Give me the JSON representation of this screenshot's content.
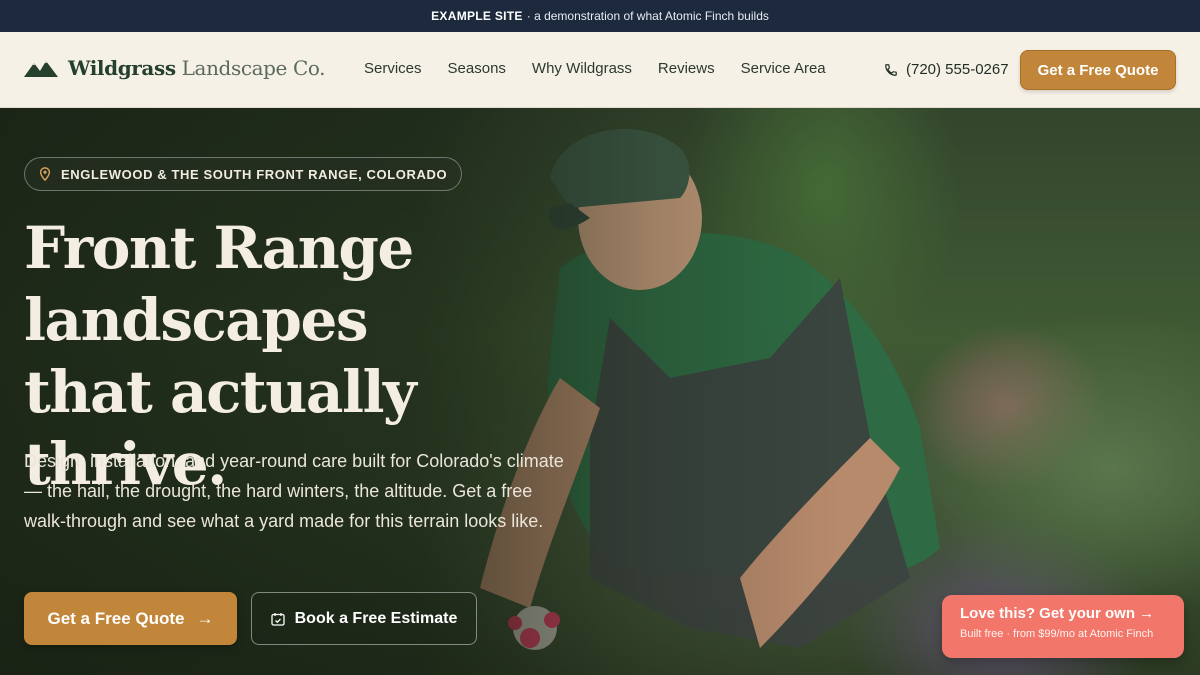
{
  "banner": {
    "strong": "EXAMPLE SITE",
    "rest": "· a demonstration of what Atomic Finch builds"
  },
  "brand": {
    "name_strong": "Wildgrass",
    "name_rest": "Landscape Co.",
    "icon": "mountain-logo-icon"
  },
  "nav": {
    "links": [
      "Services",
      "Seasons",
      "Why Wildgrass",
      "Reviews",
      "Service Area"
    ],
    "phone": "(720) 555-0267",
    "quote_button": "Get a Free Quote"
  },
  "hero": {
    "location": "ENGLEWOOD & THE SOUTH FRONT RANGE, COLORADO",
    "headline": [
      "Front Range",
      "landscapes",
      "that actually thrive."
    ],
    "subtext": "Design, installation, and year-round care built for Colorado's climate — the hail, the drought, the hard winters, the altitude. Get a free walk-through and see what a yard made for this terrain looks like.",
    "primary_button": "Get a Free Quote",
    "primary_arrow": "→",
    "secondary_button": "Book a Free Estimate"
  },
  "promo": {
    "title": "Love this? Get your own →",
    "subtitle": "Built free · from $99/mo at Atomic Finch"
  },
  "colors": {
    "accent": "#c2863a",
    "banner_bg": "#1d2a3d",
    "nav_bg": "#f6f1e7",
    "promo_bg": "#f2766a",
    "brand_green": "#26402e"
  }
}
